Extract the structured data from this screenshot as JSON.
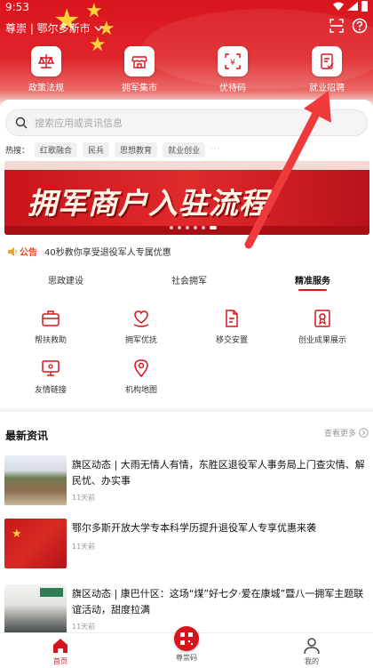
{
  "status_bar": {
    "time": "9:53"
  },
  "location": {
    "text": "尊崇 | 鄂尔多斯市"
  },
  "quick_actions": [
    {
      "label": "政策法规",
      "icon": "scale-icon"
    },
    {
      "label": "拥军集市",
      "icon": "store-icon"
    },
    {
      "label": "优待码",
      "icon": "qr-coupon-icon"
    },
    {
      "label": "就业招聘",
      "icon": "job-icon"
    }
  ],
  "search": {
    "placeholder": "搜索应用或资讯信息"
  },
  "hot_search": {
    "label": "热搜：",
    "tags": [
      "红歌融合",
      "民兵",
      "思想教育",
      "就业创业"
    ],
    "more": "···"
  },
  "banner": {
    "text": "拥军商户入驻流程"
  },
  "notice": {
    "label": "公告",
    "text": "40秒教你享受退役军人专属优惠"
  },
  "service_tabs": [
    {
      "label": "思政建设",
      "active": false
    },
    {
      "label": "社会拥军",
      "active": false
    },
    {
      "label": "精准服务",
      "active": true
    }
  ],
  "services": [
    {
      "label": "帮扶救助",
      "icon": "briefcase-icon"
    },
    {
      "label": "拥军优抚",
      "icon": "heart-hands-icon"
    },
    {
      "label": "移交安置",
      "icon": "document-icon"
    },
    {
      "label": "创业成果展示",
      "icon": "certificate-icon"
    },
    {
      "label": "友情链接",
      "icon": "monitor-link-icon"
    },
    {
      "label": "机构地图",
      "icon": "map-pin-icon"
    }
  ],
  "news": {
    "title": "最新资讯",
    "more": "查看更多",
    "items": [
      {
        "title": "旗区动态 | 大雨无情人有情，东胜区退役军人事务局上门查灾情、解民忧、办实事",
        "time": "11天前"
      },
      {
        "title": "鄂尔多斯开放大学专本科学历提升退役军人专享优惠来袭",
        "time": "11天前"
      },
      {
        "title": "旗区动态 | 康巴什区：这场“煤”好七夕·爱在康城”暨八一拥军主题联谊活动，甜度拉满",
        "time": "11天前"
      }
    ]
  },
  "bottom_nav": [
    {
      "label": "首页",
      "active": true
    },
    {
      "label": "尊崇码",
      "active": false
    },
    {
      "label": "我的",
      "active": false
    }
  ],
  "colors": {
    "primary": "#d9131b",
    "notice": "#e6471c"
  }
}
